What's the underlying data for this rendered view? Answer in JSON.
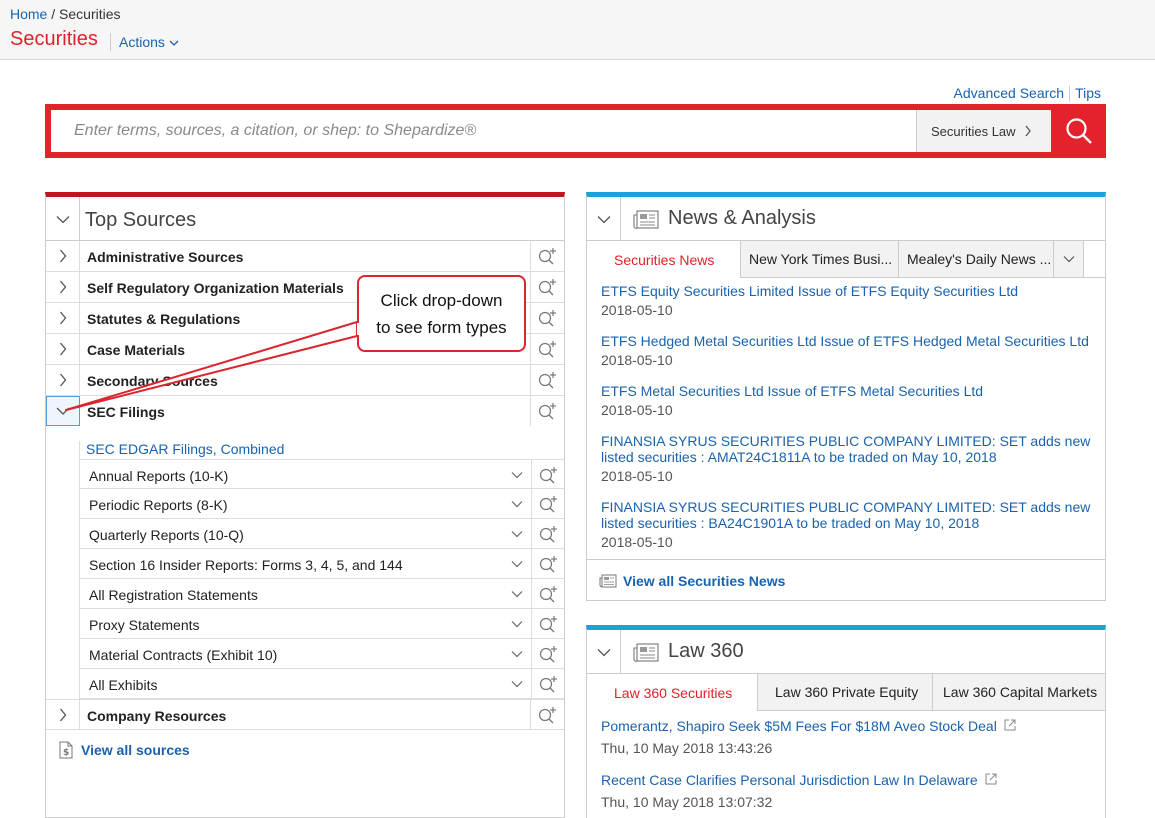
{
  "header": {
    "breadcrumb_home": "Home",
    "breadcrumb_sep": "/",
    "breadcrumb_current": "Securities",
    "title": "Securities",
    "actions_label": "Actions"
  },
  "top_links": {
    "advanced_search": "Advanced Search",
    "tips": "Tips"
  },
  "search": {
    "placeholder": "Enter terms, sources, a citation, or shep: to Shepardize®",
    "scope": "Securities Law",
    "icon": "search-icon"
  },
  "top_sources": {
    "title": "Top Sources",
    "items": [
      {
        "label": "Administrative Sources"
      },
      {
        "label": "Self Regulatory Organization Materials"
      },
      {
        "label": "Statutes & Regulations"
      },
      {
        "label": "Case Materials"
      },
      {
        "label": "Secondary Sources"
      },
      {
        "label": "SEC Filings"
      }
    ],
    "sec_combined": "SEC EDGAR Filings, Combined",
    "sec_sub_items": [
      {
        "label": "Annual Reports (10-K)"
      },
      {
        "label": "Periodic Reports (8-K)"
      },
      {
        "label": "Quarterly Reports (10-Q)"
      },
      {
        "label": "Section 16 Insider Reports: Forms 3, 4, 5, and 144"
      },
      {
        "label": "All Registration Statements"
      },
      {
        "label": "Proxy Statements"
      },
      {
        "label": "Material Contracts (Exhibit 10)"
      },
      {
        "label": "All Exhibits"
      }
    ],
    "company_resources": "Company Resources",
    "view_all": "View all sources"
  },
  "callout": {
    "line1": "Click drop-down",
    "line2": "to see form types"
  },
  "news_analysis": {
    "title": "News & Analysis",
    "tabs": [
      "Securities News",
      "New York Times Busi...",
      "Mealey's Daily News ..."
    ],
    "items": [
      {
        "headline": "ETFS Equity Securities Limited Issue of ETFS Equity Securities Ltd",
        "date": "2018-05-10"
      },
      {
        "headline": "ETFS Hedged Metal Securities Ltd Issue of ETFS Hedged Metal Securities Ltd",
        "date": "2018-05-10"
      },
      {
        "headline": "ETFS Metal Securities Ltd Issue of ETFS Metal Securities Ltd",
        "date": "2018-05-10"
      },
      {
        "headline": "FINANSIA SYRUS SECURITIES PUBLIC COMPANY LIMITED: SET adds new listed securities : AMAT24C1811A to be traded on May 10, 2018",
        "date": "2018-05-10"
      },
      {
        "headline": "FINANSIA SYRUS SECURITIES PUBLIC COMPANY LIMITED: SET adds new listed securities : BA24C1901A to be traded on May 10, 2018",
        "date": "2018-05-10"
      }
    ],
    "view_all": "View all Securities News"
  },
  "law360": {
    "title": "Law 360",
    "tabs": [
      "Law 360 Securities",
      "Law 360 Private Equity",
      "Law 360 Capital Markets"
    ],
    "items": [
      {
        "headline": "Pomerantz, Shapiro Seek $5M Fees For $18M Aveo Stock Deal",
        "date": "Thu, 10 May 2018 13:43:26"
      },
      {
        "headline": "Recent Case Clarifies Personal Jurisdiction Law In Delaware",
        "date": "Thu, 10 May 2018 13:07:32"
      }
    ]
  },
  "colors": {
    "brand_red": "#e3222b",
    "link_blue": "#1a62ad",
    "panel_blue": "#1aa3d4"
  }
}
